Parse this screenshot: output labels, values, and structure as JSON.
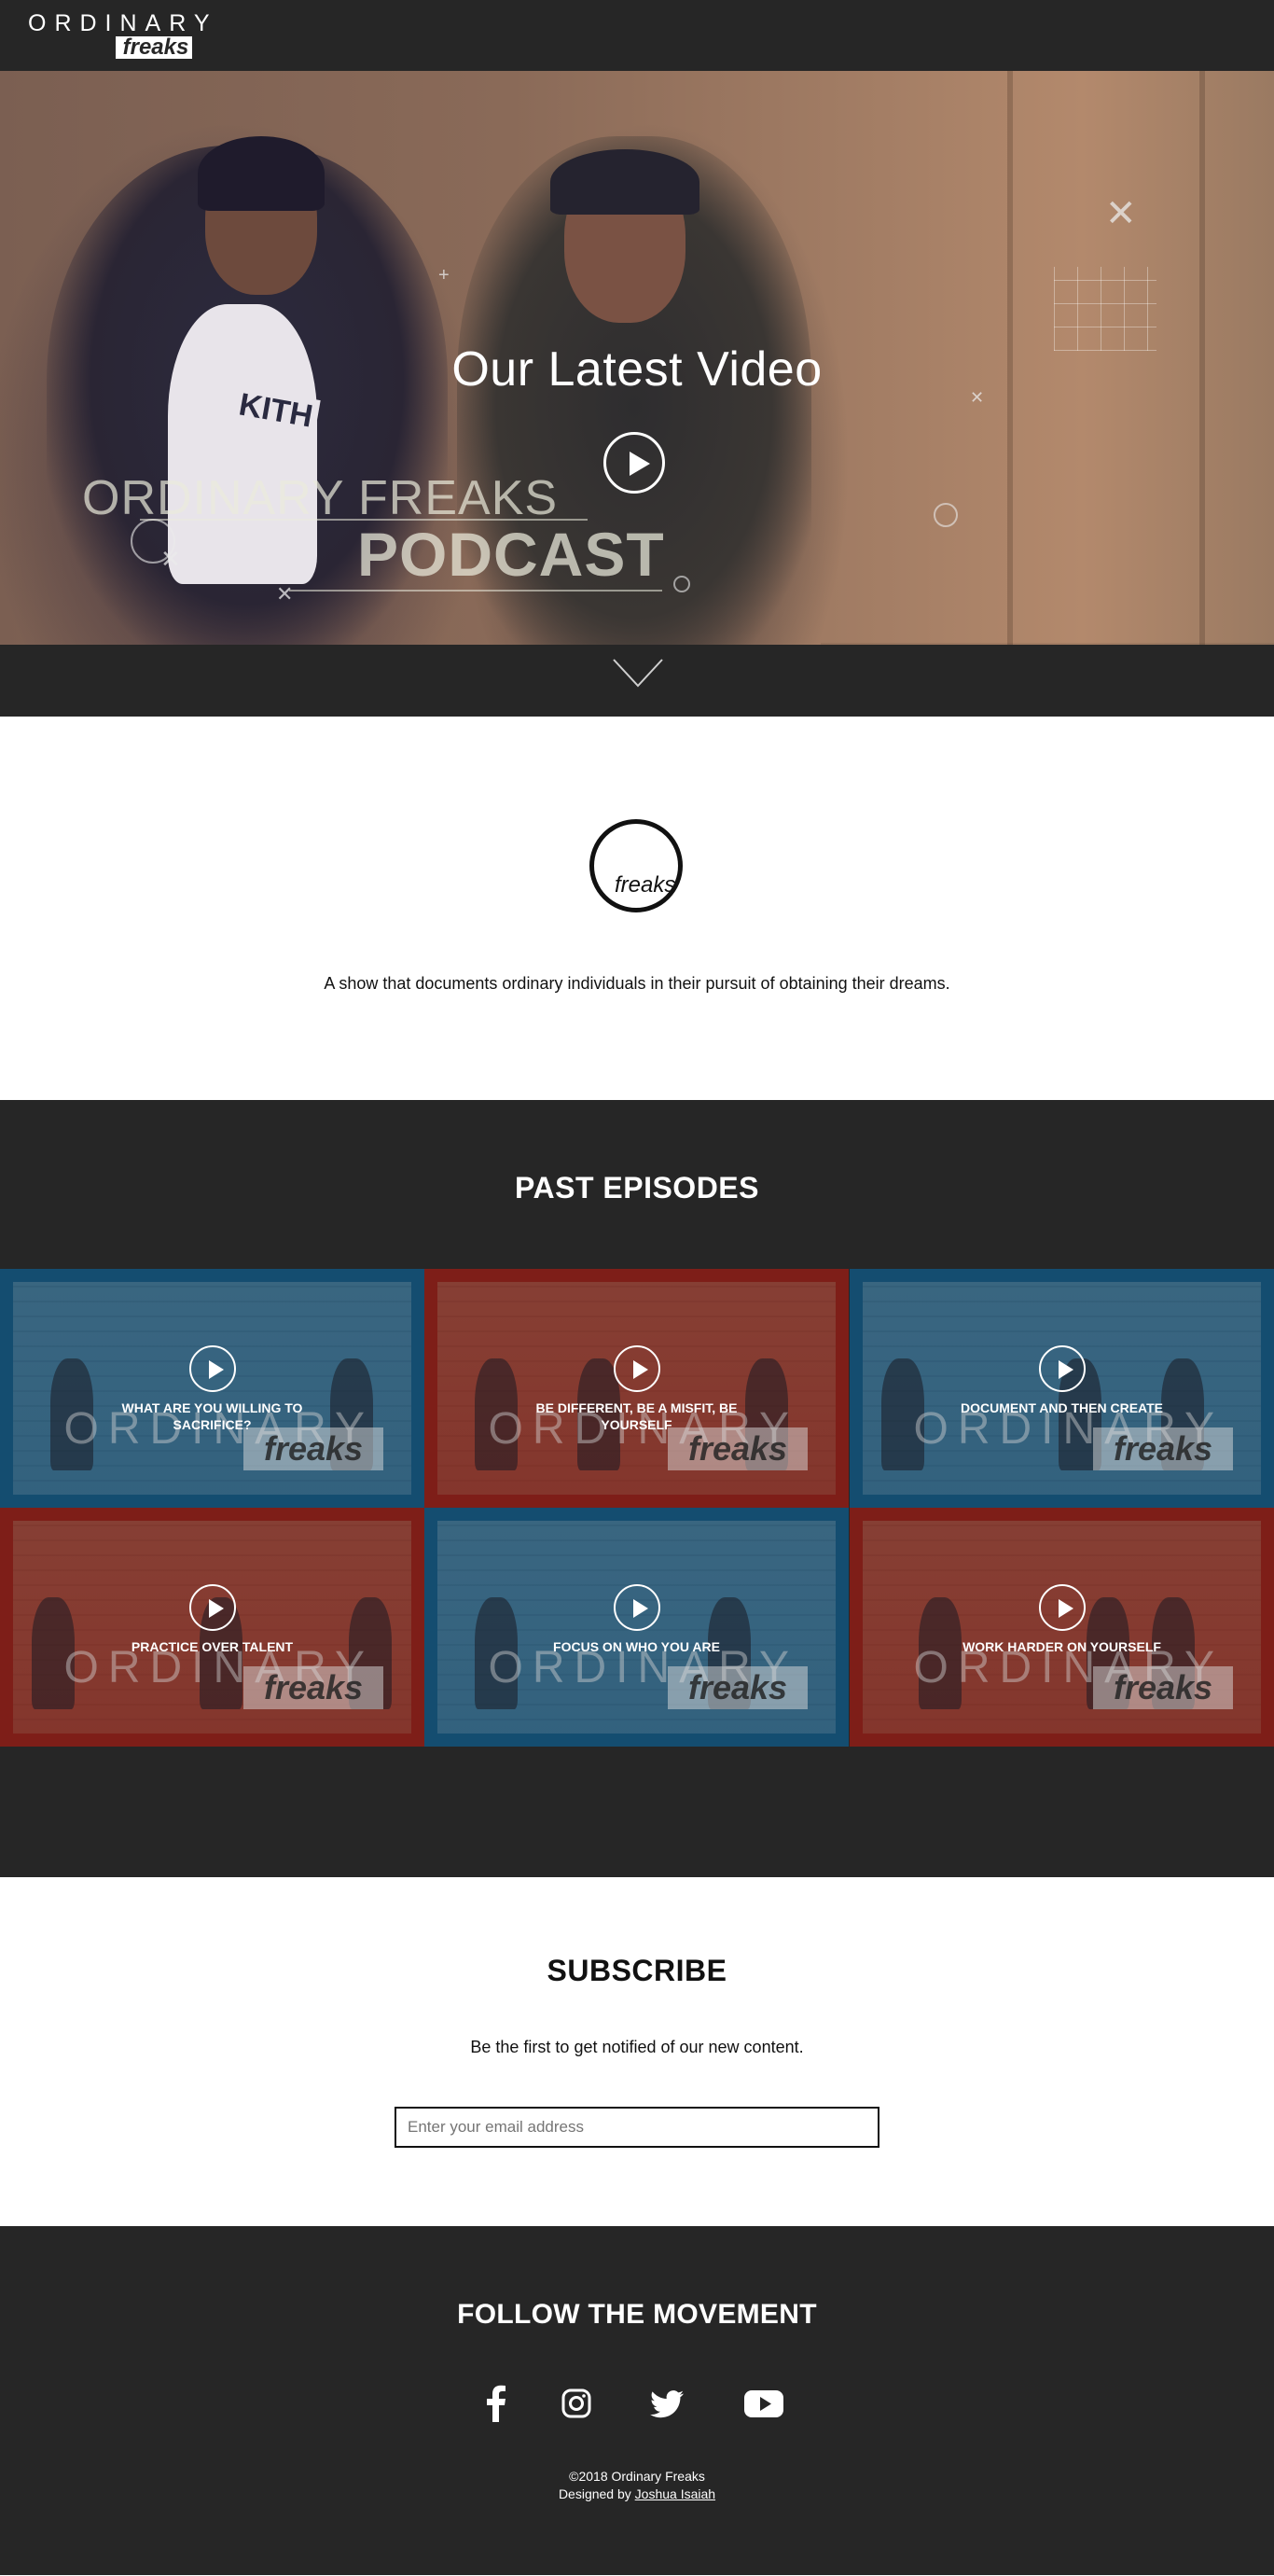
{
  "header": {
    "logo_top": "ORDINARY",
    "logo_box": "freaks"
  },
  "hero": {
    "title": "Our Latest Video",
    "overlay_line1": "ORDINARY FREAKS",
    "overlay_line2": "PODCAST",
    "shirt_text": "KITH"
  },
  "about": {
    "logo_text": "freaks",
    "description": "A show that documents ordinary individuals in their pursuit of obtaining their dreams."
  },
  "episodes": {
    "title": "PAST EPISODES",
    "watermark_top": "ORDINARY",
    "watermark_box": "freaks",
    "items": [
      {
        "label": "WHAT ARE YOU WILLING TO SACRIFICE?",
        "color": "blue"
      },
      {
        "label": "BE DIFFERENT, BE A MISFIT, BE YOURSELF",
        "color": "red"
      },
      {
        "label": "DOCUMENT AND THEN CREATE",
        "color": "blue"
      },
      {
        "label": "PRACTICE OVER TALENT",
        "color": "red"
      },
      {
        "label": "FOCUS ON WHO YOU ARE",
        "color": "blue"
      },
      {
        "label": "WORK HARDER ON YOURSELF",
        "color": "red"
      }
    ]
  },
  "subscribe": {
    "title": "SUBSCRIBE",
    "description": "Be the first to get notified of our new content.",
    "email_placeholder": "Enter your email address"
  },
  "footer": {
    "title": "FOLLOW THE MOVEMENT",
    "social": [
      "facebook-icon",
      "instagram-icon",
      "twitter-icon",
      "youtube-icon"
    ],
    "copyright": "©2018 Ordinary Freaks",
    "designed_prefix": "Designed by ",
    "designer": "Joshua Isaiah"
  },
  "colors": {
    "dark": "#262626",
    "episode_blue": "#144d70",
    "episode_red": "#7e1e18"
  }
}
